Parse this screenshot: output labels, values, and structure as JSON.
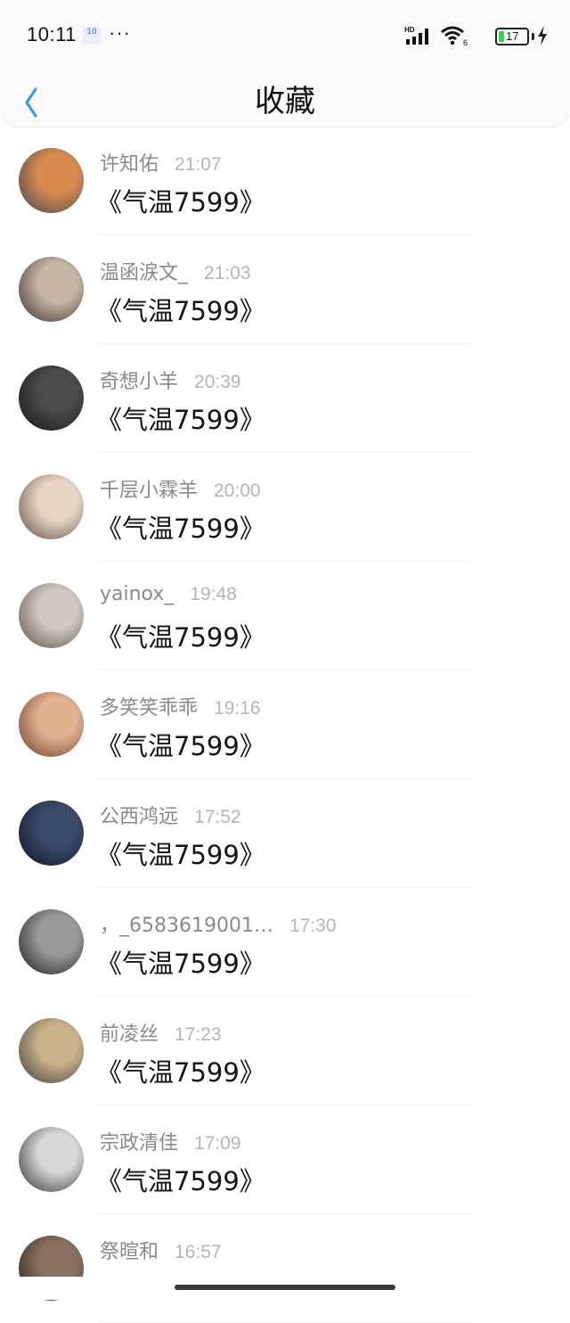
{
  "status_bar": {
    "time": "10:11",
    "notification_badge": "10",
    "more": "···",
    "network": "HD",
    "wifi_sub": "6",
    "battery_level": "17"
  },
  "nav": {
    "back_icon": "chevron-left-icon",
    "title": "收藏"
  },
  "colors": {
    "accent": "#2f9be8",
    "battery": "#3ccf4e"
  },
  "items": [
    {
      "name": "许知佑",
      "time": "21:07",
      "title": "《气温7599》",
      "avatar_colors": [
        "#d98a4f",
        "#3c4254"
      ]
    },
    {
      "name": "温函涙文_",
      "time": "21:03",
      "title": "《气温7599》",
      "avatar_colors": [
        "#c5b6a6",
        "#3a2a25"
      ]
    },
    {
      "name": "奇想小羊",
      "time": "20:39",
      "title": "《气温7599》",
      "avatar_colors": [
        "#4b4b4b",
        "#141414"
      ]
    },
    {
      "name": "千层小霖羊",
      "time": "20:00",
      "title": "《气温7599》",
      "avatar_colors": [
        "#e8d6c4",
        "#5a4740"
      ]
    },
    {
      "name": "yainox_",
      "time": "19:48",
      "title": "《气温7599》",
      "avatar_colors": [
        "#cfc9c2",
        "#574a40"
      ]
    },
    {
      "name": "多笑笑乖乖",
      "time": "19:16",
      "title": "《气温7599》",
      "avatar_colors": [
        "#e0b290",
        "#6a3a2a"
      ]
    },
    {
      "name": "公西鸿远",
      "time": "17:52",
      "title": "《气温7599》",
      "avatar_colors": [
        "#3a4a6a",
        "#0f1422"
      ]
    },
    {
      "name": "，_6583619001…",
      "time": "17:30",
      "title": "《气温7599》",
      "avatar_colors": [
        "#9a9a9a",
        "#1a1a1a"
      ]
    },
    {
      "name": "前凌丝",
      "time": "17:23",
      "title": "《气温7599》",
      "avatar_colors": [
        "#c9b38a",
        "#3c3a35"
      ]
    },
    {
      "name": "宗政清佳",
      "time": "17:09",
      "title": "《气温7599》",
      "avatar_colors": [
        "#d8d8d8",
        "#2a2a2a"
      ]
    },
    {
      "name": "祭暄和",
      "time": "16:57",
      "title": "",
      "avatar_colors": [
        "#8a7060",
        "#2a1e18"
      ]
    }
  ]
}
